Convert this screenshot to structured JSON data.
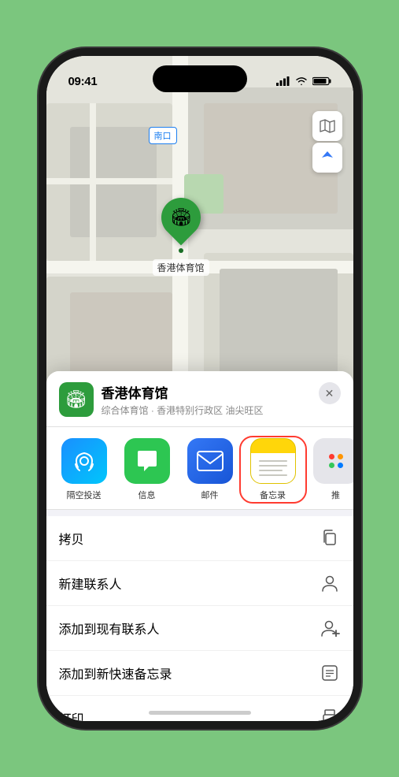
{
  "status": {
    "time": "09:41",
    "time_arrow": "▶"
  },
  "map": {
    "label": "南口"
  },
  "venue": {
    "name": "香港体育馆",
    "subtitle": "综合体育馆 · 香港特别行政区 油尖旺区",
    "icon": "🏟"
  },
  "share_apps": [
    {
      "id": "airdrop",
      "label": "隔空投送",
      "icon": "📡"
    },
    {
      "id": "messages",
      "label": "信息",
      "icon": "💬"
    },
    {
      "id": "mail",
      "label": "邮件",
      "icon": "✉️"
    },
    {
      "id": "notes",
      "label": "备忘录",
      "icon": ""
    },
    {
      "id": "more",
      "label": "推",
      "icon": "..."
    }
  ],
  "actions": [
    {
      "id": "copy",
      "label": "拷贝",
      "icon": "copy"
    },
    {
      "id": "new-contact",
      "label": "新建联系人",
      "icon": "person"
    },
    {
      "id": "add-existing",
      "label": "添加到现有联系人",
      "icon": "person-add"
    },
    {
      "id": "quick-note",
      "label": "添加到新快速备忘录",
      "icon": "note"
    },
    {
      "id": "print",
      "label": "打印",
      "icon": "print"
    }
  ],
  "close_label": "✕"
}
